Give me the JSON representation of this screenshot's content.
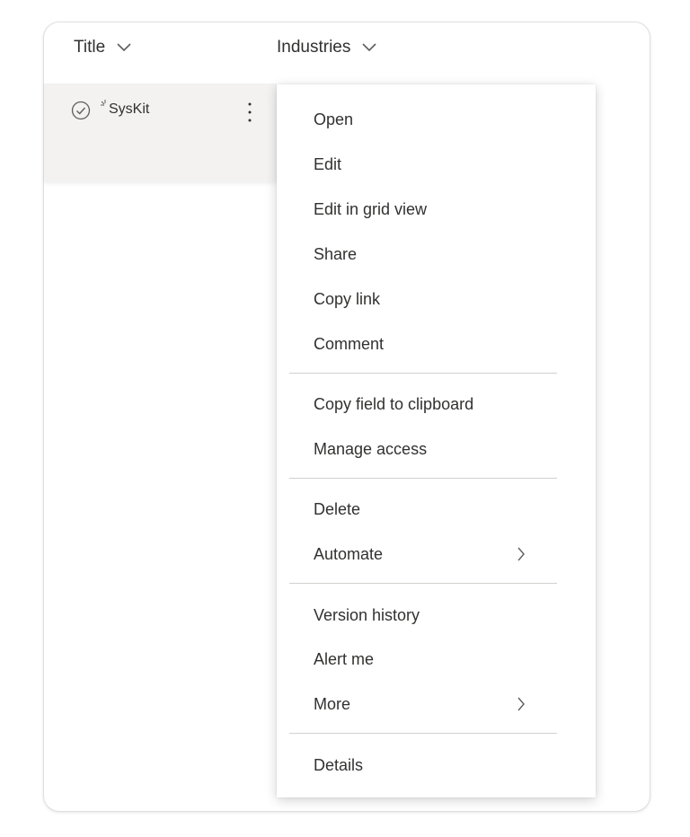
{
  "columns": {
    "title_label": "Title",
    "industries_label": "Industries"
  },
  "row": {
    "title": "SysKit"
  },
  "context_menu": {
    "items": [
      {
        "label": "Open"
      },
      {
        "label": "Edit"
      },
      {
        "label": "Edit in grid view"
      },
      {
        "label": "Share"
      },
      {
        "label": "Copy link"
      },
      {
        "label": "Comment"
      },
      {
        "label": "Copy field to clipboard"
      },
      {
        "label": "Manage access"
      },
      {
        "label": "Delete"
      },
      {
        "label": "Automate",
        "has_submenu": true
      },
      {
        "label": "Version history"
      },
      {
        "label": "Alert me"
      },
      {
        "label": "More",
        "has_submenu": true
      },
      {
        "label": "Details"
      }
    ]
  },
  "icons": {
    "column_sort": "chevron-down-icon",
    "row_select": "check-circle-icon",
    "row_new": "new-sparkle-icon",
    "row_more": "more-vertical-icon",
    "submenu": "chevron-right-icon"
  },
  "colors": {
    "text": "#323130",
    "row_background": "#f3f2f1",
    "divider": "#d2d0ce",
    "icon": "#605e5c"
  }
}
